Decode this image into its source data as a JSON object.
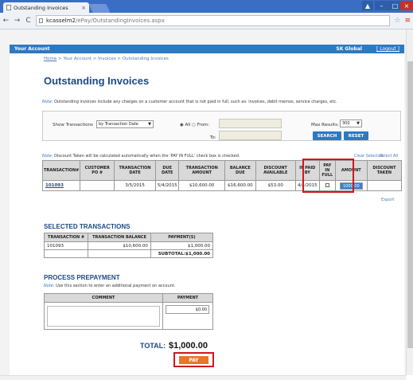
{
  "browser": {
    "tab_title": "Outstanding Invoices",
    "tab_close": "×",
    "url_host": "kcasselm2",
    "url_path": "/ePay/OutstandingInvoices.aspx",
    "back": "←",
    "forward": "→",
    "reload": "C",
    "star": "☆",
    "menu": "≡",
    "win_min": "–",
    "win_max": "□",
    "win_close": "×",
    "win_user": "▲"
  },
  "header": {
    "section": "Your Account",
    "company": "SK Global",
    "logout": "[ Logout ]"
  },
  "breadcrumb": {
    "home": "Home",
    "rest": " > Your Account > Invoices > Outstanding Invoices"
  },
  "page_title": "Outstanding Invoices",
  "note1_label": "Note:",
  "note1_text": " Outstanding invoices include any charges on a customer account that is not paid in full, such as: invoices, debit memos, service charges, etc.",
  "filter": {
    "show_label": "Show Transactions",
    "show_value": "by Transaction Date",
    "caret": "▼",
    "all_label": "◉ All  ○  From:",
    "to_label": "To:",
    "max_label": "Max Results:",
    "max_value": "300",
    "search": "SEARCH",
    "reset": "RESET"
  },
  "note2_label": "Note:",
  "note2_text": " Discount Taken will be calculated automatically when the 'PAY IN FULL' check box is checked.",
  "clear_selected": "Clear Selected",
  "select_all": "Select All",
  "txn_table": {
    "headers": [
      "TRANSACTION#",
      "CUSTOMER PO #",
      "TRANSACTION DATE",
      "DUE DATE",
      "TRANSACTION AMOUNT",
      "BALANCE DUE",
      "DISCOUNT AVAILABLE",
      "IF PAID BY",
      "PAY IN FULL",
      "AMOUNT",
      "DISCOUNT TAKEN"
    ],
    "row": {
      "txn": "101093",
      "po": "",
      "txn_date": "3/5/2015",
      "due_date": "5/4/2015",
      "amount": "$10,600.00",
      "balance": "$16,600.00",
      "discount": "$53.00",
      "if_paid_by": "4/4/2015",
      "amount_input": "1000.00",
      "discount_taken": ""
    }
  },
  "export": "Export",
  "selected": {
    "title": "SELECTED TRANSACTIONS",
    "headers": [
      "TRANSACTION #",
      "TRANSACTION BALANCE",
      "PAYMENT(S)"
    ],
    "row": [
      "101093",
      "$10,600.00",
      "$1,000.00"
    ],
    "subtotal_label": "SUBTOTAL:",
    "subtotal_value": "$1,000.00"
  },
  "prepayment": {
    "title": "PROCESS PREPAYMENT",
    "note_label": "Note:",
    "note_text": " Use this section to enter an additional payment on account.",
    "headers": [
      "COMMENT",
      "PAYMENT"
    ],
    "payment_value": "$0.00"
  },
  "total_label": "TOTAL:",
  "total_value": "$1,000.00",
  "pay_button": "PAY"
}
